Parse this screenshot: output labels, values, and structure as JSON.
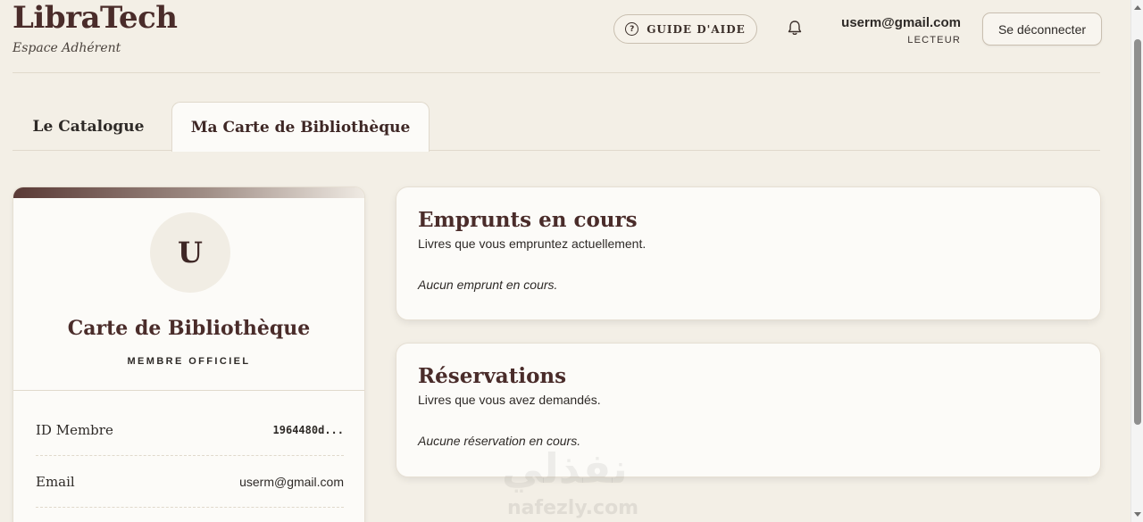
{
  "brand": {
    "title": "LibraTech",
    "subtitle": "Espace Adhérent"
  },
  "header": {
    "help_label": "GUIDE D'AIDE",
    "help_icon": "question-circle-icon",
    "notification_icon": "bell-icon",
    "user_email": "userm@gmail.com",
    "user_role": "LECTEUR",
    "logout_label": "Se déconnecter"
  },
  "tabs": [
    {
      "label": "Le Catalogue",
      "active": false
    },
    {
      "label": "Ma Carte de Bibliothèque",
      "active": true
    }
  ],
  "card": {
    "avatar_initial": "U",
    "title": "Carte de Bibliothèque",
    "badge": "MEMBRE OFFICIEL",
    "rows": [
      {
        "label": "ID Membre",
        "value": "1964480d..."
      },
      {
        "label": "Email",
        "value": "userm@gmail.com"
      }
    ]
  },
  "loans": {
    "title": "Emprunts en cours",
    "subtitle": "Livres que vous empruntez actuellement.",
    "empty": "Aucun emprunt en cours."
  },
  "reservations": {
    "title": "Réservations",
    "subtitle": "Livres que vous avez demandés.",
    "empty": "Aucune réservation en cours."
  },
  "watermark": {
    "arabic": "نفذلي",
    "latin": "nafezly.com"
  },
  "colors": {
    "background": "#f3efe6",
    "accent_dark": "#4a2c2a",
    "card_surface": "#fcfbf8"
  }
}
